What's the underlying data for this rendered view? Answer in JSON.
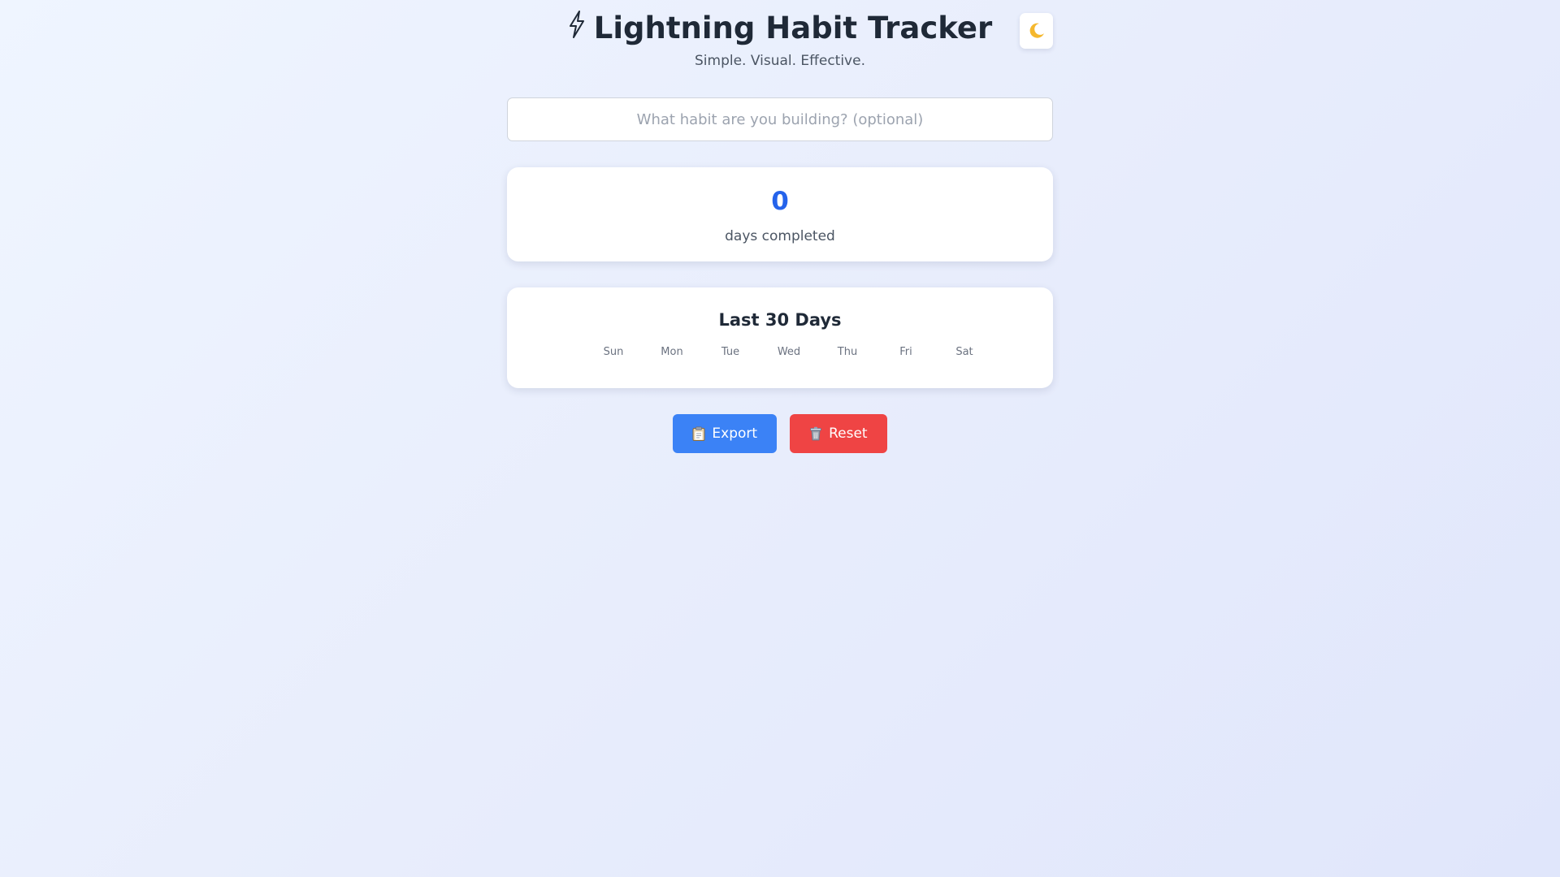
{
  "header": {
    "title_icon": "lightning-bolt-icon",
    "title": "Lightning Habit Tracker",
    "subtitle": "Simple. Visual. Effective.",
    "theme_toggle_icon": "moon-icon"
  },
  "habit_input": {
    "value": "",
    "placeholder": "What habit are you building? (optional)"
  },
  "stats": {
    "count": "0",
    "label": "days completed"
  },
  "calendar": {
    "title": "Last 30 Days",
    "weekdays": [
      "Sun",
      "Mon",
      "Tue",
      "Wed",
      "Thu",
      "Fri",
      "Sat"
    ]
  },
  "actions": {
    "export_label": "Export",
    "export_icon": "clipboard-icon",
    "reset_label": "Reset",
    "reset_icon": "trash-icon"
  },
  "colors": {
    "accent": "#2563eb",
    "export_button": "#3b82f6",
    "reset_button": "#ef4444",
    "moon": "#f5b82e"
  }
}
